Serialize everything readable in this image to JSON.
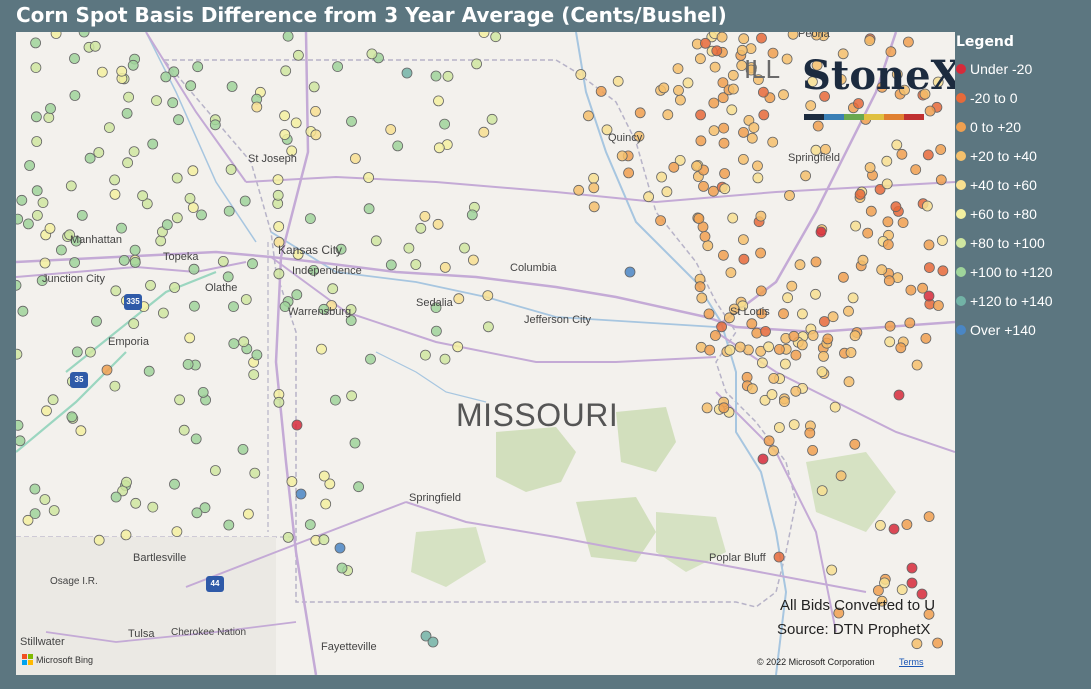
{
  "title": "Corn Spot Basis Difference from 3 Year Average (Cents/Bushel)",
  "legend": {
    "title": "Legend",
    "items": [
      {
        "label": "Under -20",
        "color": "#d62a3a"
      },
      {
        "label": "-20 to 0",
        "color": "#e66a3a"
      },
      {
        "label": "0 to +20",
        "color": "#f0a050"
      },
      {
        "label": "+20 to +40",
        "color": "#f4c06c"
      },
      {
        "label": "+40 to +60",
        "color": "#f7df90"
      },
      {
        "label": "+60 to +80",
        "color": "#f3f0a0"
      },
      {
        "label": "+80 to +100",
        "color": "#cfe6a0"
      },
      {
        "label": "+100 to +120",
        "color": "#9fd49a"
      },
      {
        "label": "+120 to +140",
        "color": "#72b3a6"
      },
      {
        "label": "Over +140",
        "color": "#4a86c4"
      }
    ]
  },
  "logo": {
    "text": "StoneX",
    "bar_colors": [
      "#1c2b3f",
      "#3a7fb5",
      "#6aa84f",
      "#e0c040",
      "#e08030",
      "#c03030"
    ]
  },
  "map": {
    "state_label": "MISSOURI",
    "partial_state_label": "ILL",
    "places": [
      "St Joseph",
      "Manhattan",
      "Topeka",
      "Junction City",
      "Kansas City",
      "Independence",
      "Olathe",
      "Emporia",
      "Warrensburg",
      "Sedalia",
      "Columbia",
      "Jefferson City",
      "St Louis",
      "Springfield",
      "Bartlesville",
      "Osage I.R.",
      "Tulsa",
      "Cherokee Nation",
      "Stillwater",
      "Fayetteville",
      "Poplar Bluff",
      "Peoria",
      "Springfield",
      "Quincy"
    ],
    "highways": [
      "335",
      "35",
      "44"
    ],
    "notes": [
      "All Bids Converted to U",
      "Source: DTN ProphetX"
    ],
    "copyright": "© 2022 Microsoft Corporation",
    "terms": "Terms",
    "attribution": "Microsoft Bing"
  }
}
